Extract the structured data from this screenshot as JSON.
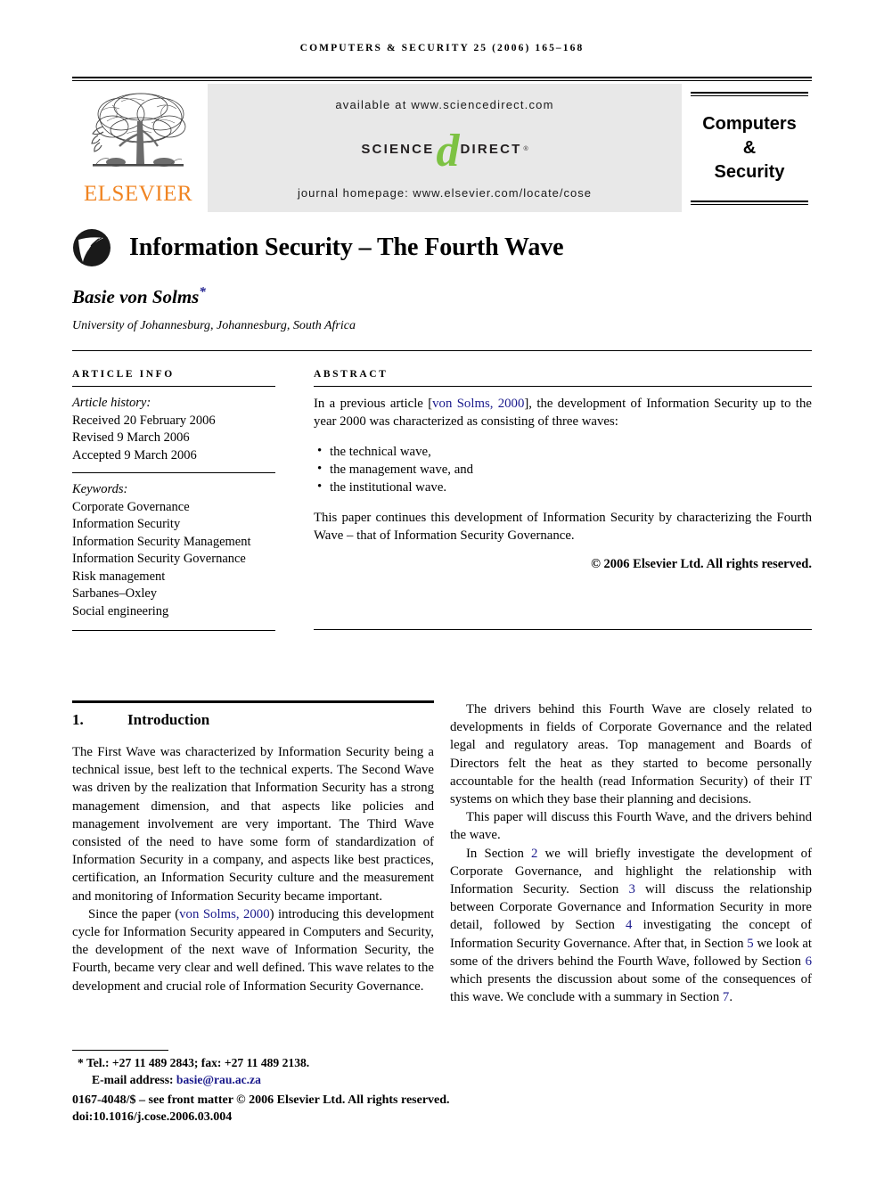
{
  "running_head": "Computers & Security 25 (2006) 165–168",
  "masthead": {
    "publisher_name": "ELSEVIER",
    "publisher_logo_icon": "elsevier-tree-icon",
    "available_at": "available at www.sciencedirect.com",
    "sciencedirect_science": "SCIENCE",
    "sciencedirect_d": "d",
    "sciencedirect_direct": "DIRECT",
    "sciencedirect_registered": "®",
    "journal_homepage": "journal homepage: www.elsevier.com/locate/cose",
    "journal_box": [
      "Computers",
      "&",
      "Security"
    ]
  },
  "article": {
    "wave_icon": "wave-swirl-icon",
    "title": "Information Security – The Fourth Wave",
    "author": "Basie von Solms",
    "author_footnote_marker": "*",
    "affiliation": "University of Johannesburg, Johannesburg, South Africa"
  },
  "article_info": {
    "label": "ARTICLE INFO",
    "history_label": "Article history:",
    "history": [
      "Received 20 February 2006",
      "Revised 9 March 2006",
      "Accepted 9 March 2006"
    ],
    "keywords_label": "Keywords:",
    "keywords": [
      "Corporate Governance",
      "Information Security",
      "Information Security Management",
      "Information Security Governance",
      "Risk management",
      "Sarbanes–Oxley",
      "Social engineering"
    ]
  },
  "abstract": {
    "label": "ABSTRACT",
    "intro_before_cite": "In a previous article [",
    "intro_cite": "von Solms, 2000",
    "intro_after_cite": "], the development of Information Security up to the year 2000 was characterized as consisting of three waves:",
    "waves": [
      "the technical wave,",
      "the management wave, and",
      "the institutional wave."
    ],
    "closing": "This paper continues this development of Information Security by characterizing the Fourth Wave – that of Information Security Governance.",
    "copyright": "© 2006 Elsevier Ltd. All rights reserved."
  },
  "introduction": {
    "number": "1.",
    "heading": "Introduction",
    "p1": "The First Wave was characterized by Information Security being a technical issue, best left to the technical experts. The Second Wave was driven by the realization that Information Security has a strong management dimension, and that aspects like policies and management involvement are very important. The Third Wave consisted of the need to have some form of standardization of Information Security in a company, and aspects like best practices, certification, an Information Security culture and the measurement and monitoring of Information Security became important.",
    "p2_before_cite": "Since the paper (",
    "p2_cite": "von Solms, 2000",
    "p2_after_cite": ") introducing this development cycle for Information Security appeared in Computers and Security, the development of the next wave of Information Security, the Fourth, became very clear and well defined. This wave relates to the development and crucial role of Information Security Governance.",
    "p3": "The drivers behind this Fourth Wave are closely related to developments in fields of Corporate Governance and the related legal and regulatory areas. Top management and Boards of Directors felt the heat as they started to become personally accountable for the health (read Information Security) of their IT systems on which they base their planning and decisions.",
    "p4": "This paper will discuss this Fourth Wave, and the drivers behind the wave.",
    "p5_a": "In Section ",
    "p5_s2": "2",
    "p5_b": " we will briefly investigate the development of Corporate Governance, and highlight the relationship with Information Security. Section ",
    "p5_s3": "3",
    "p5_c": " will discuss the relationship between Corporate Governance and Information Security in more detail, followed by Section ",
    "p5_s4": "4",
    "p5_d": " investigating the concept of Information Security Governance. After that, in Section ",
    "p5_s5": "5",
    "p5_e": " we look at some of the drivers behind the Fourth Wave, followed by Section ",
    "p5_s6": "6",
    "p5_f": " which presents the discussion about some of the consequences of this wave. We conclude with a summary in Section ",
    "p5_s7": "7",
    "p5_g": "."
  },
  "footnotes": {
    "marker": "*",
    "tel_fax": "Tel.: +27 11 489 2843; fax: +27 11 489 2138.",
    "email_label": "E-mail address: ",
    "email": "basie@rau.ac.za",
    "front_matter": "0167-4048/$ – see front matter © 2006 Elsevier Ltd. All rights reserved.",
    "doi": "doi:10.1016/j.cose.2006.03.004"
  },
  "colors": {
    "link_blue": "#1a1a8c",
    "elsevier_orange": "#F08422",
    "sciencedirect_green": "#7DC243",
    "banner_gray": "#e8e8e8"
  }
}
